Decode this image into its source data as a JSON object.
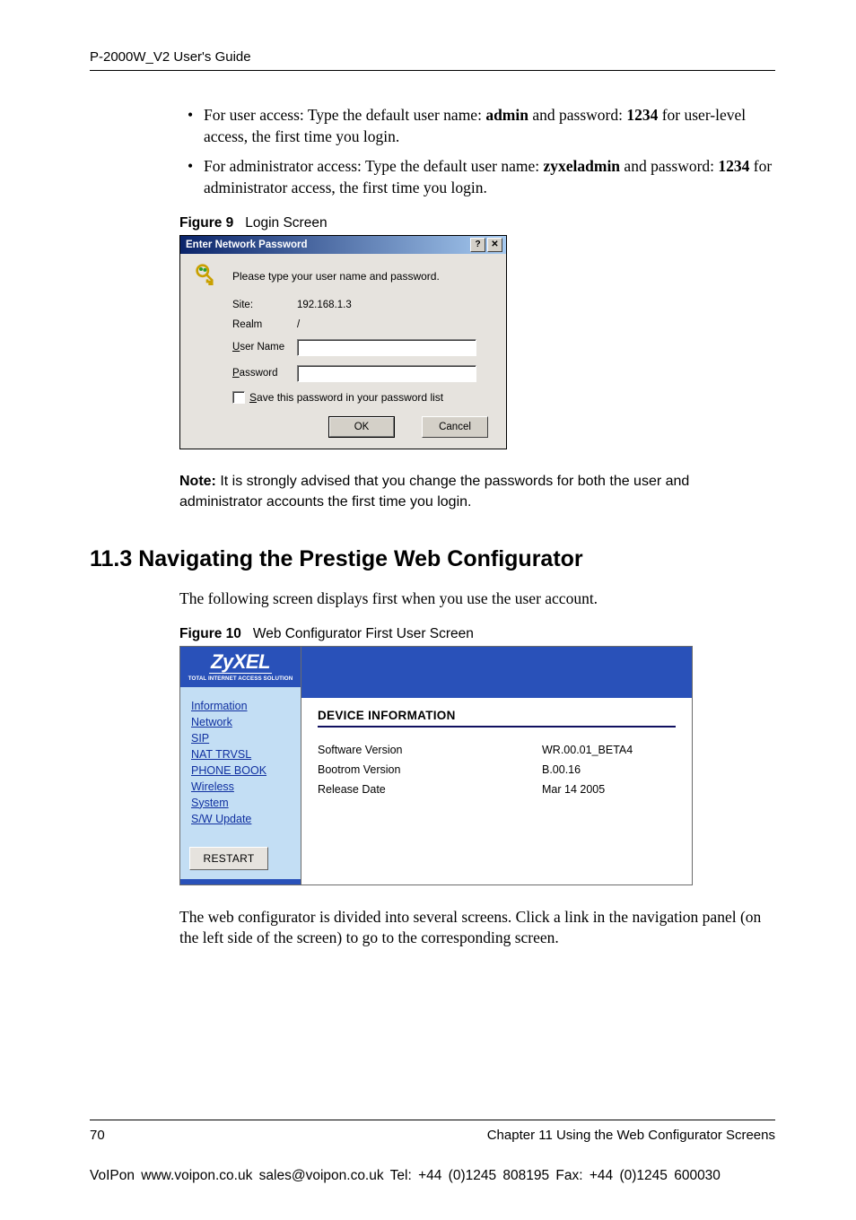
{
  "header": "P-2000W_V2 User's Guide",
  "bullets": [
    {
      "pre": "For user access: Type the default user name: ",
      "b1": "admin",
      "mid": " and password: ",
      "b2": "1234",
      "post": " for user-level access, the first time you login."
    },
    {
      "pre": "For administrator access: Type the default user name: ",
      "b1": "zyxeladmin",
      "mid": " and password: ",
      "b2": "1234",
      "post": " for administrator access, the first time you login."
    }
  ],
  "fig9": {
    "num": "Figure 9",
    "title": "Login Screen"
  },
  "dlg": {
    "title": "Enter Network Password",
    "prompt": "Please type your user name and password.",
    "site_label": "Site:",
    "site_value": "192.168.1.3",
    "realm_label": "Realm",
    "realm_value": "/",
    "user_label_u": "U",
    "user_label_rest": "ser Name",
    "pass_label_u": "P",
    "pass_label_rest": "assword",
    "save_u": "S",
    "save_rest": "ave this password in your password list",
    "ok": "OK",
    "cancel": "Cancel"
  },
  "note": {
    "label": "Note:",
    "text": "It is strongly advised that you change the passwords for both the user and administrator accounts the first time you login."
  },
  "section": "11.3  Navigating the Prestige Web Configurator",
  "para1": "The following screen displays first when you use the user account.",
  "fig10": {
    "num": "Figure 10",
    "title": "Web Configurator First User Screen"
  },
  "app": {
    "logo": "ZyXEL",
    "tagline": "TOTAL INTERNET ACCESS SOLUTION",
    "nav": [
      "Information",
      "Network",
      "SIP",
      "NAT TRVSL",
      "PHONE BOOK",
      "Wireless",
      "System",
      "S/W Update"
    ],
    "restart": "RESTART",
    "heading": "DEVICE INFORMATION",
    "rows": [
      {
        "k": "Software Version",
        "v": "WR.00.01_BETA4"
      },
      {
        "k": "Bootrom Version",
        "v": "B.00.16"
      },
      {
        "k": "Release Date",
        "v": "Mar 14 2005"
      }
    ]
  },
  "para2": "The web configurator is divided into several screens. Click a link in the navigation panel (on the left side of the screen) to go to the corresponding screen.",
  "footer": {
    "page": "70",
    "chapter": "Chapter 11 Using the Web Configurator Screens"
  },
  "voipon": "VoIPon    www.voipon.co.uk    sales@voipon.co.uk    Tel: +44 (0)1245 808195    Fax: +44 (0)1245 600030"
}
